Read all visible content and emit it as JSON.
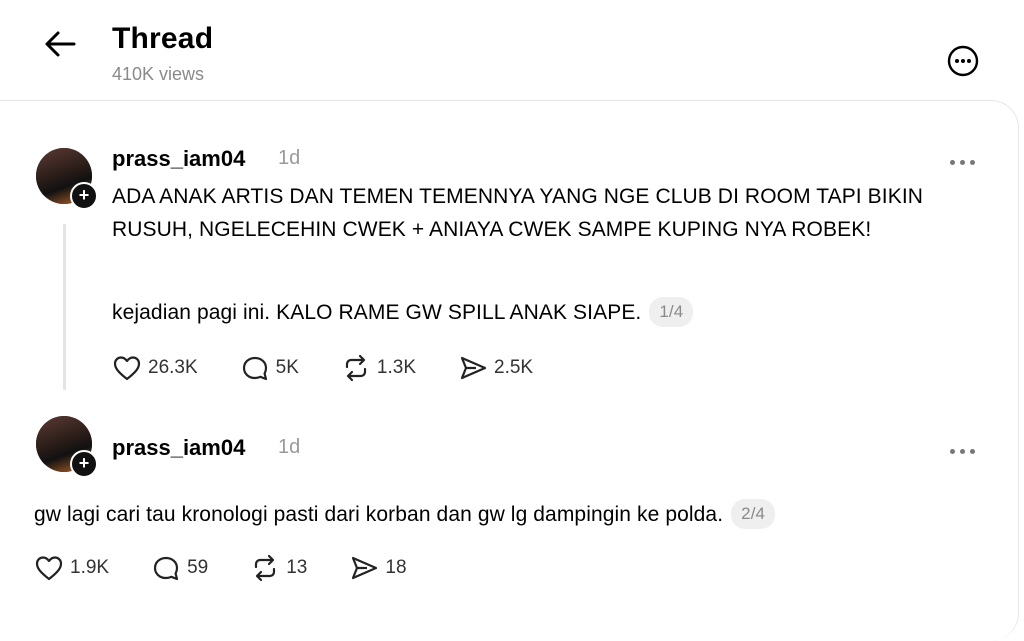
{
  "header": {
    "title": "Thread",
    "views": "410K views"
  },
  "posts": [
    {
      "username": "prass_iam04",
      "time": "1d",
      "paragraphs": [
        "ADA ANAK ARTIS DAN TEMEN TEMENNYA YANG NGE CLUB DI ROOM TAPI BIKIN RUSUH, NGELECEHIN CWEK + ANIAYA CWEK SAMPE KUPING NYA ROBEK!",
        "kejadian pagi ini. KALO RAME GW SPILL ANAK SIAPE."
      ],
      "page": "1/4",
      "likes": "26.3K",
      "replies": "5K",
      "reposts": "1.3K",
      "shares": "2.5K"
    },
    {
      "username": "prass_iam04",
      "time": "1d",
      "paragraphs": [
        "gw lagi cari tau kronologi pasti dari korban dan gw lg dampingin ke polda."
      ],
      "page": "2/4",
      "likes": "1.9K",
      "replies": "59",
      "reposts": "13",
      "shares": "18"
    }
  ],
  "icons": {
    "back": "arrow-left-icon",
    "more": "more-circle-icon",
    "like": "heart-icon",
    "reply": "comment-icon",
    "repost": "repost-icon",
    "share": "send-icon"
  }
}
